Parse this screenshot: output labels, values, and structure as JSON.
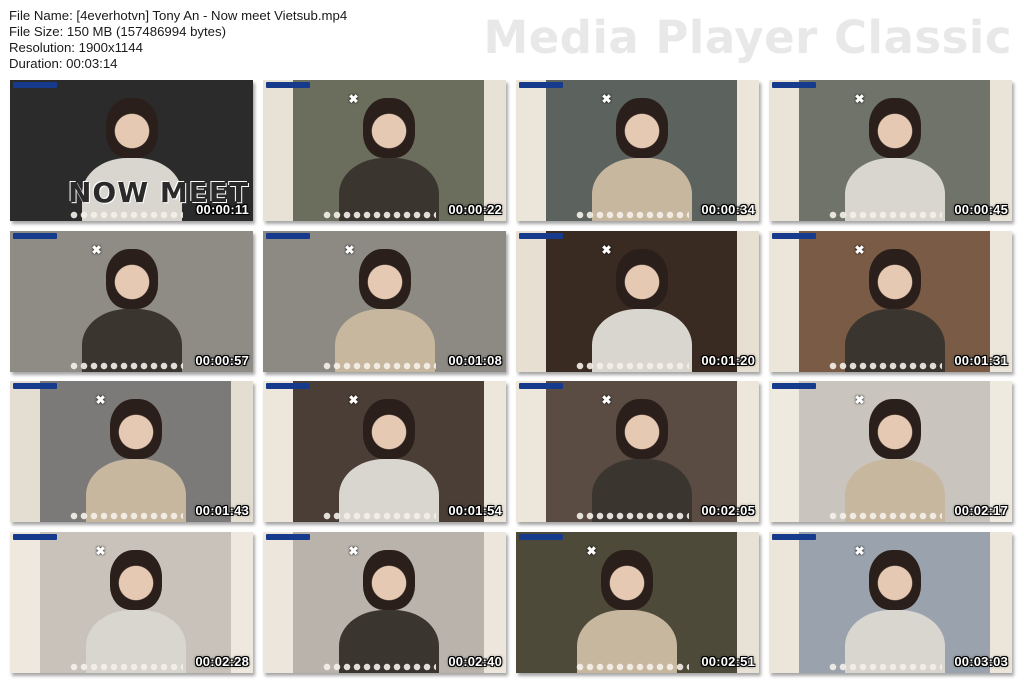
{
  "info": {
    "file_name": "File Name: [4everhotvn] Tony An - Now meet Vietsub.mp4",
    "file_size": "File Size: 150 MB (157486994 bytes)",
    "resolution": "Resolution: 1900x1144",
    "duration": "Duration: 00:03:14"
  },
  "brand": "Media Player Classic",
  "thumbnails": [
    {
      "time": "00:00:11",
      "title": "NOW MEET",
      "bg": "#2b2b2b",
      "accent": "#d8d4cc"
    },
    {
      "time": "00:00:22",
      "bg": "#6b6e5c",
      "accent": "#e8e2d6"
    },
    {
      "time": "00:00:34",
      "bg": "#5c625e",
      "accent": "#ebe5da"
    },
    {
      "time": "00:00:45",
      "bg": "#70736a",
      "accent": "#e9e3d8"
    },
    {
      "time": "00:00:57",
      "bg": "#8f8c86",
      "accent": "#bbb7b0"
    },
    {
      "time": "00:01:08",
      "bg": "#8d8a84",
      "accent": "#c6c2ba"
    },
    {
      "time": "00:01:20",
      "bg": "#3a2b22",
      "accent": "#e6dfd2"
    },
    {
      "time": "00:01:31",
      "bg": "#7a5c46",
      "accent": "#ebe5da"
    },
    {
      "time": "00:01:43",
      "bg": "#7c7a78",
      "accent": "#e4ded2"
    },
    {
      "time": "00:01:54",
      "bg": "#4b3e36",
      "accent": "#ece6db"
    },
    {
      "time": "00:02:05",
      "bg": "#5a4c43",
      "accent": "#ece6db"
    },
    {
      "time": "00:02:17",
      "bg": "#c9c5be",
      "accent": "#efeae0"
    },
    {
      "time": "00:02:28",
      "bg": "#c8c2bb",
      "accent": "#eee8de"
    },
    {
      "time": "00:02:40",
      "bg": "#b9b3ab",
      "accent": "#ece6dc"
    },
    {
      "time": "00:02:51",
      "bg": "#4d4a3a",
      "accent": "#e8e2d6"
    },
    {
      "time": "00:03:03",
      "bg": "#9aa3ad",
      "accent": "#ebe5da"
    }
  ]
}
